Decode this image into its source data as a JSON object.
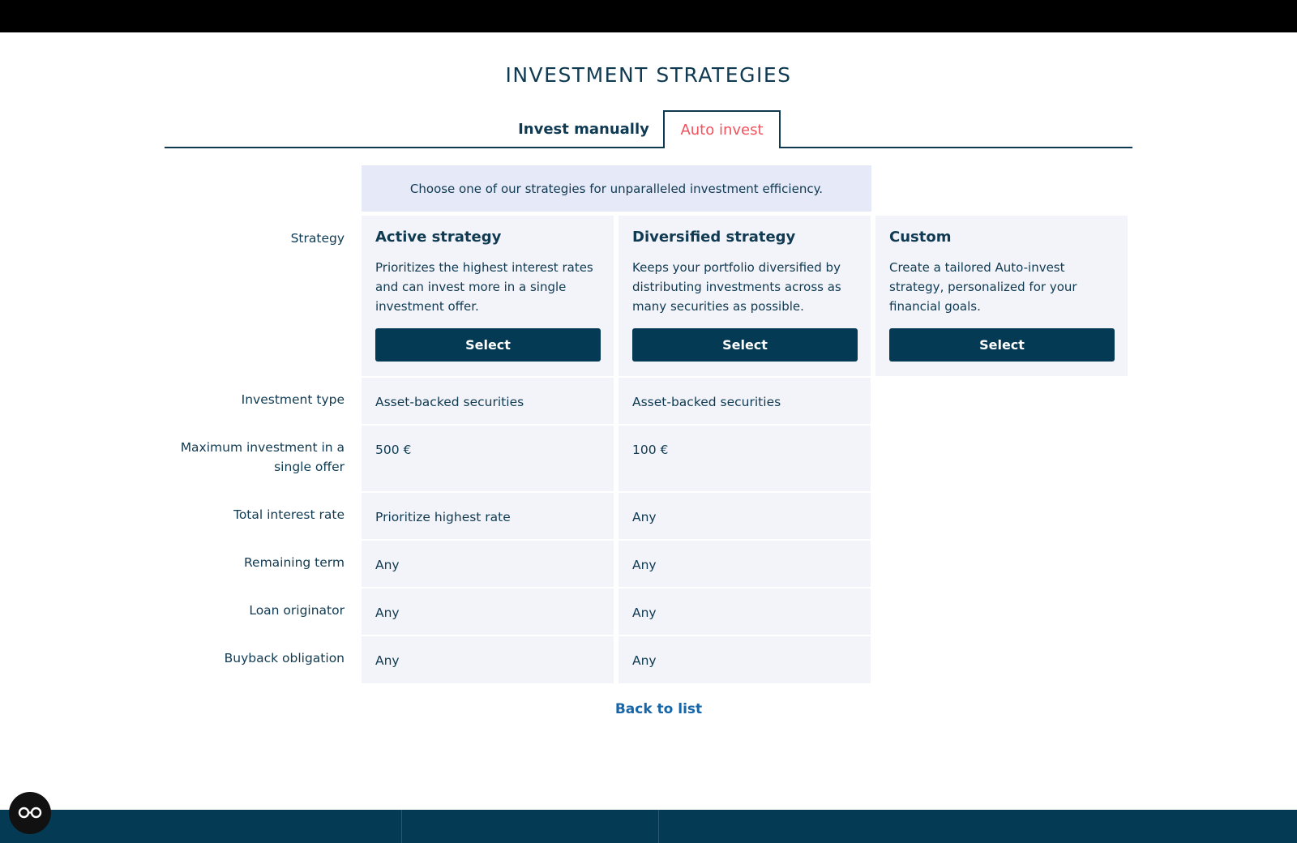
{
  "page": {
    "title": "INVESTMENT STRATEGIES"
  },
  "tabs": [
    {
      "label": "Invest manually",
      "active": false
    },
    {
      "label": "Auto invest",
      "active": true
    }
  ],
  "intro": "Choose one of our strategies for unparalleled investment efficiency.",
  "row_labels": {
    "strategy": "Strategy",
    "investment_type": "Investment type",
    "max_investment": "Maximum investment in a single offer",
    "total_interest": "Total interest rate",
    "remaining_term": "Remaining term",
    "loan_originator": "Loan originator",
    "buyback": "Buyback obligation"
  },
  "strategies": [
    {
      "title": "Active strategy",
      "description": "Prioritizes the highest interest rates and can invest more in a single investment offer.",
      "button": "Select",
      "investment_type": "Asset-backed securities",
      "max_investment": "500 €",
      "total_interest": "Prioritize highest rate",
      "remaining_term": "Any",
      "loan_originator": "Any",
      "buyback": "Any"
    },
    {
      "title": "Diversified strategy",
      "description": "Keeps your portfolio diversified by distributing investments across as many securities as possible.",
      "button": "Select",
      "investment_type": "Asset-backed securities",
      "max_investment": "100 €",
      "total_interest": "Any",
      "remaining_term": "Any",
      "loan_originator": "Any",
      "buyback": "Any"
    },
    {
      "title": "Custom",
      "description": "Create a tailored Auto-invest strategy, personalized for your financial goals.",
      "button": "Select"
    }
  ],
  "back_link": "Back to list",
  "colors": {
    "primary": "#053a55",
    "accent": "#f2515c",
    "link": "#1565a8",
    "card_bg": "#f3f4f9",
    "intro_bg": "#e6e9f7"
  },
  "icons": {
    "accessibility": "glasses-icon"
  }
}
